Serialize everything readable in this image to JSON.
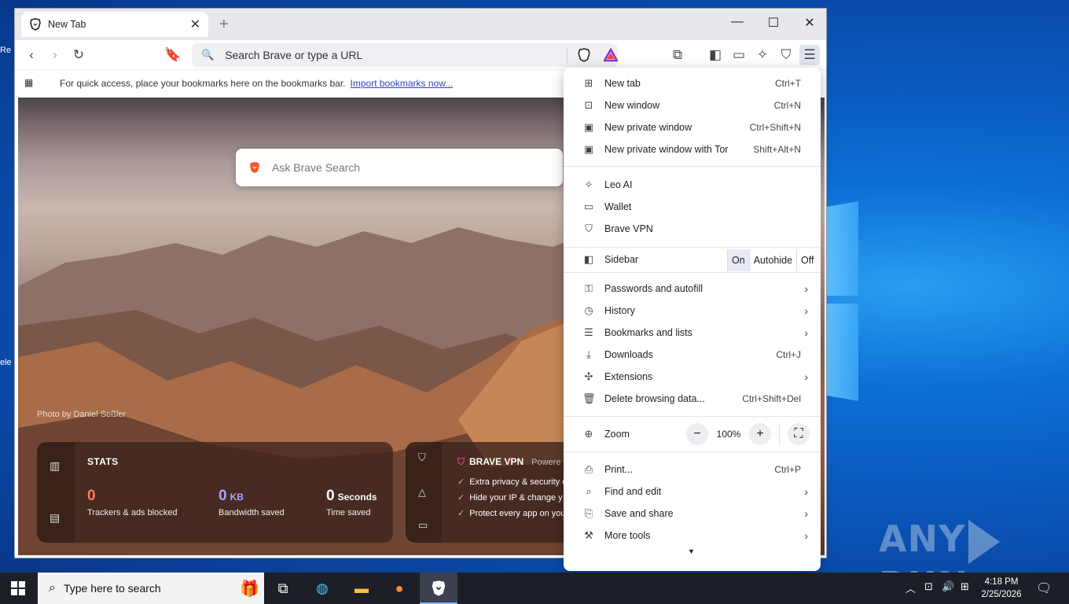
{
  "browser": {
    "tab_title": "New Tab",
    "new_tab_symbol": "+",
    "omnibox_placeholder": "Search Brave or type a URL",
    "bookmarks_message": "For quick access, place your bookmarks here on the bookmarks bar.",
    "import_link": "Import bookmarks now...",
    "search_placeholder": "Ask Brave Search",
    "photo_credit": "Photo by Daniel Seßler"
  },
  "stats": {
    "title": "STATS",
    "trackers_value": "0",
    "trackers_label": "Trackers & ads blocked",
    "bandwidth_value": "0",
    "bandwidth_unit": "KB",
    "bandwidth_label": "Bandwidth saved",
    "time_value": "0",
    "time_unit": "Seconds",
    "time_label": "Time saved",
    "trackers_color": "#ff7a5c",
    "bandwidth_color": "#a7a4ff"
  },
  "vpn": {
    "title": "BRAVE VPN",
    "powered": "Powere",
    "items": [
      "Extra privacy & security o",
      "Hide your IP & change y",
      "Protect every app on you"
    ]
  },
  "menu": {
    "new_tab": "New tab",
    "new_tab_sc": "Ctrl+T",
    "new_window": "New window",
    "new_window_sc": "Ctrl+N",
    "new_private": "New private window",
    "new_private_sc": "Ctrl+Shift+N",
    "new_tor": "New private window with Tor",
    "new_tor_sc": "Shift+Alt+N",
    "leo": "Leo AI",
    "wallet": "Wallet",
    "vpn": "Brave VPN",
    "sidebar": "Sidebar",
    "sidebar_on": "On",
    "sidebar_autohide": "Autohide",
    "sidebar_off": "Off",
    "passwords": "Passwords and autofill",
    "history": "History",
    "bookmarks": "Bookmarks and lists",
    "downloads": "Downloads",
    "downloads_sc": "Ctrl+J",
    "extensions": "Extensions",
    "delete_data": "Delete browsing data...",
    "delete_data_sc": "Ctrl+Shift+Del",
    "zoom": "Zoom",
    "zoom_level": "100%",
    "zoom_minus": "−",
    "zoom_plus": "+",
    "print": "Print...",
    "print_sc": "Ctrl+P",
    "find_edit": "Find and edit",
    "save_share": "Save and share",
    "more_tools": "More tools"
  },
  "taskbar": {
    "search_placeholder": "Type here to search",
    "time": "4:18 PM",
    "date": "2/25/2026"
  },
  "desktop": {
    "watermark_left": "ANY",
    "watermark_right": "RUN"
  },
  "colors": {
    "brave_orange": "#fb542b",
    "vpn_accent": "#e0408a",
    "accent_blue": "#2e46c8"
  }
}
